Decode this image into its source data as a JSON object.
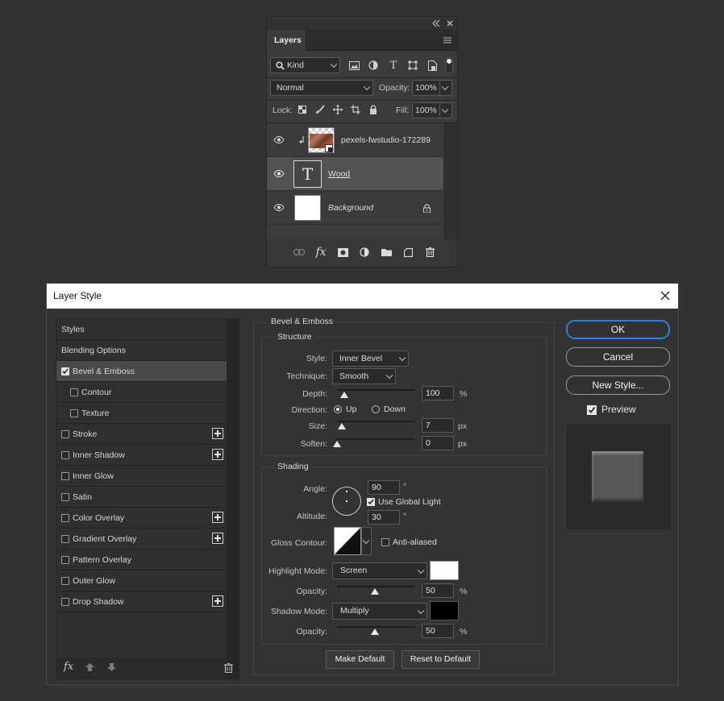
{
  "layers_panel": {
    "tab_label": "Layers",
    "filter": {
      "kind_label": "Kind"
    },
    "blend_mode": "Normal",
    "opacity_label": "Opacity:",
    "opacity_value": "100%",
    "lock_label": "Lock:",
    "fill_label": "Fill:",
    "fill_value": "100%",
    "layers": [
      {
        "name": "pexels-fwstudio-172289",
        "type": "smart-object"
      },
      {
        "name": "Wood",
        "type": "text",
        "thumb_letter": "T"
      },
      {
        "name": "Background",
        "type": "background"
      }
    ]
  },
  "layer_style": {
    "title": "Layer Style",
    "list": [
      {
        "label": "Styles"
      },
      {
        "label": "Blending Options"
      },
      {
        "label": "Bevel & Emboss",
        "checked": true,
        "selected": true
      },
      {
        "label": "Contour",
        "checked": false
      },
      {
        "label": "Texture",
        "checked": false
      },
      {
        "label": "Stroke",
        "checked": false,
        "plus": true
      },
      {
        "label": "Inner Shadow",
        "checked": false,
        "plus": true
      },
      {
        "label": "Inner Glow",
        "checked": false
      },
      {
        "label": "Satin",
        "checked": false
      },
      {
        "label": "Color Overlay",
        "checked": false,
        "plus": true
      },
      {
        "label": "Gradient Overlay",
        "checked": false,
        "plus": true
      },
      {
        "label": "Pattern Overlay",
        "checked": false
      },
      {
        "label": "Outer Glow",
        "checked": false
      },
      {
        "label": "Drop Shadow",
        "checked": false,
        "plus": true
      }
    ],
    "footer_fx": "fx",
    "bevel": {
      "section_title": "Bevel & Emboss",
      "structure_title": "Structure",
      "style_label": "Style:",
      "style_value": "Inner Bevel",
      "technique_label": "Technique:",
      "technique_value": "Smooth",
      "depth_label": "Depth:",
      "depth_value": "100",
      "depth_unit": "%",
      "direction_label": "Direction:",
      "direction_up": "Up",
      "direction_down": "Down",
      "size_label": "Size:",
      "size_value": "7",
      "size_unit": "px",
      "soften_label": "Soften:",
      "soften_value": "0",
      "soften_unit": "px"
    },
    "shading": {
      "title": "Shading",
      "angle_label": "Angle:",
      "angle_value": "90",
      "angle_unit": "°",
      "use_global_light": "Use Global Light",
      "altitude_label": "Altitude:",
      "altitude_value": "30",
      "altitude_unit": "°",
      "gloss_contour_label": "Gloss Contour:",
      "anti_aliased": "Anti-aliased",
      "highlight_mode_label": "Highlight Mode:",
      "highlight_mode_value": "Screen",
      "highlight_color": "#ffffff",
      "highlight_opacity_label": "Opacity:",
      "highlight_opacity_value": "50",
      "highlight_opacity_unit": "%",
      "shadow_mode_label": "Shadow Mode:",
      "shadow_mode_value": "Multiply",
      "shadow_color": "#000000",
      "shadow_opacity_label": "Opacity:",
      "shadow_opacity_value": "50",
      "shadow_opacity_unit": "%"
    },
    "buttons": {
      "make_default": "Make Default",
      "reset_default": "Reset to Default",
      "ok": "OK",
      "cancel": "Cancel",
      "new_style": "New Style...",
      "preview": "Preview"
    }
  }
}
